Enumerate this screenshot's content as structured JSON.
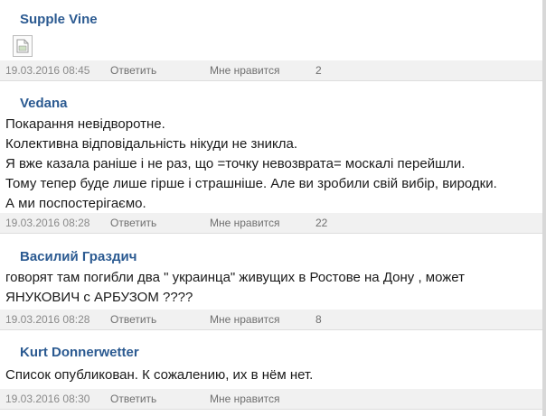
{
  "comments": [
    {
      "author": "Supple Vine",
      "text_lines": [],
      "has_image_placeholder": true,
      "date": "19.03.2016 08:45",
      "reply_label": "Ответить",
      "like_label": "Мне нравится",
      "likes": "2"
    },
    {
      "author": "Vedana",
      "text_lines": [
        "Покарання невідворотне.",
        "Колективна відповідальність нікуди не зникла.",
        "Я вже казала раніше і не раз, що =точку невозврата= москалі перейшли.",
        "Тому тепер буде лише гірше і страшніше. Але ви зробили свій вибір, виродки.",
        "А ми поспостерігаємо."
      ],
      "date": "19.03.2016 08:28",
      "reply_label": "Ответить",
      "like_label": "Мне нравится",
      "likes": "22"
    },
    {
      "author": "Василий Граздич",
      "text_lines": [
        "говорят там погибли два \" украинца\" живущих в Ростове на Дону , может",
        "ЯНУКОВИЧ с АРБУЗОМ ????"
      ],
      "date": "19.03.2016 08:28",
      "reply_label": "Ответить",
      "like_label": "Мне нравится",
      "likes": "8"
    },
    {
      "author": "Kurt Donnerwetter",
      "text_lines": [
        "Список опубликован. К сожалению, их в нём нет."
      ],
      "date": "19.03.2016 08:30",
      "reply_label": "Ответить",
      "like_label": "Мне нравится",
      "likes": ""
    }
  ]
}
